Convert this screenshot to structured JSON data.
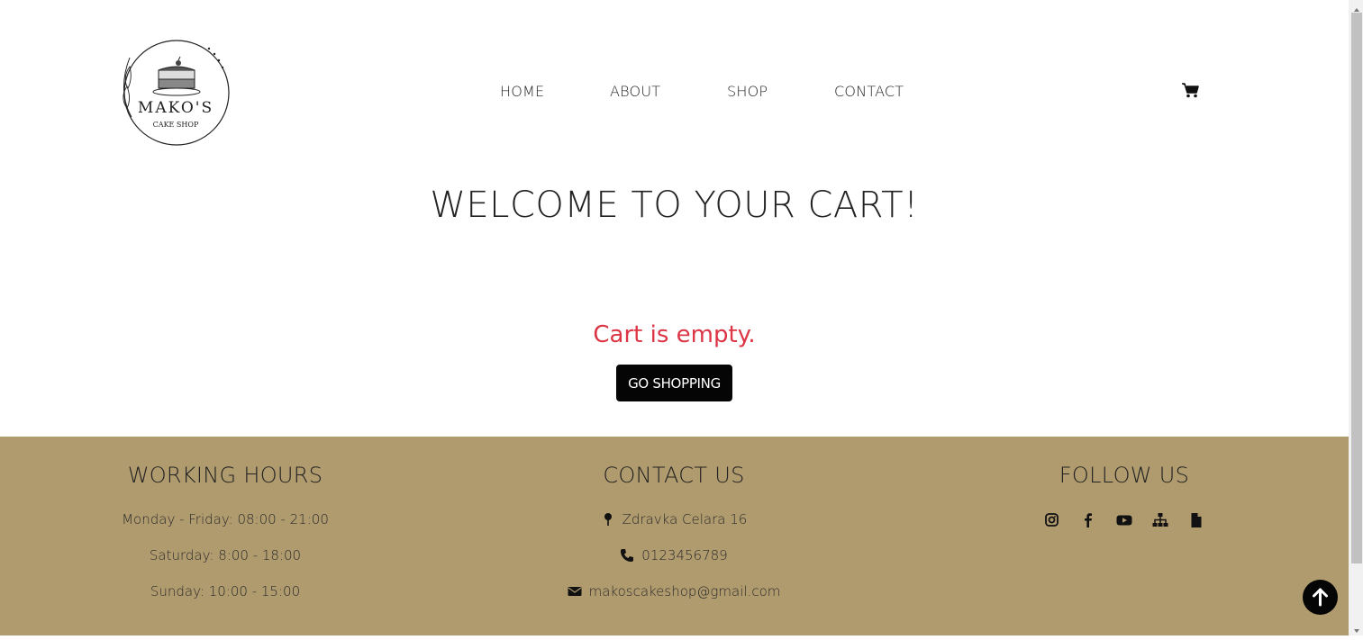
{
  "header": {
    "logo": {
      "name": "MAKO'S",
      "tagline": "CAKE SHOP"
    },
    "nav": [
      "HOME",
      "ABOUT",
      "SHOP",
      "CONTACT"
    ],
    "cart_icon": "shopping-cart-icon"
  },
  "main": {
    "title": "WELCOME TO YOUR CART!",
    "empty_message": "Cart is empty.",
    "go_shopping_label": "GO SHOPPING"
  },
  "footer": {
    "working_hours": {
      "title": "WORKING HOURS",
      "lines": [
        "Monday - Friday: 08:00 - 21:00",
        "Saturday: 8:00 - 18:00",
        "Sunday: 10:00 - 15:00"
      ]
    },
    "contact": {
      "title": "CONTACT US",
      "address": "Zdravka Celara 16",
      "phone": "0123456789",
      "email": "makoscakeshop@gmail.com"
    },
    "follow": {
      "title": "FOLLOW US",
      "icons": [
        "instagram-icon",
        "facebook-icon",
        "youtube-icon",
        "sitemap-icon",
        "document-icon"
      ]
    }
  },
  "colors": {
    "footer_bg": "#b09b6e",
    "empty_text": "#dc3545",
    "button_bg": "#050505"
  }
}
